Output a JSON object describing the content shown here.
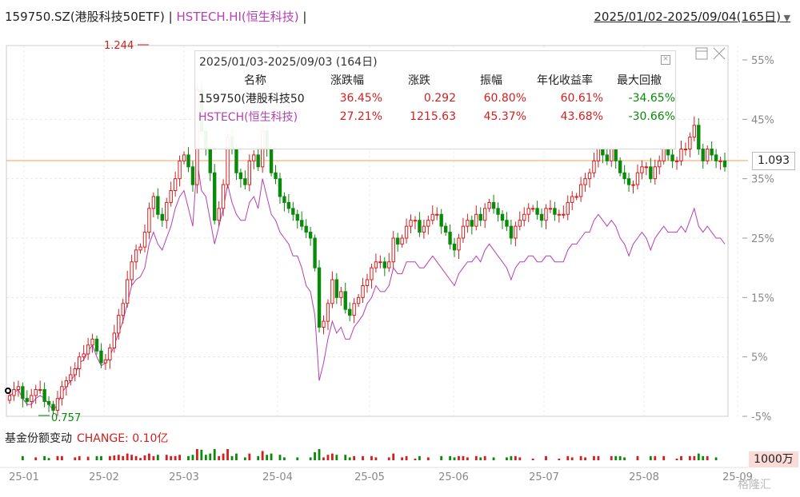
{
  "header": {
    "fund": "159750.SZ(港股科技50ETF)",
    "sep": "|",
    "index": "HSTECH.HI(恒生科技)",
    "sep2": "|",
    "range": "2025/01/02-2025/09/04(165日)"
  },
  "stats": {
    "range": "2025/01/03-2025/09/03 (164日)",
    "headers": [
      "名称",
      "涨跌幅",
      "涨跌",
      "振幅",
      "年化收益率",
      "最大回撤"
    ],
    "rows": [
      {
        "name": "159750(港股科技50",
        "chg_pct": "36.45%",
        "chg": "0.292",
        "amp": "60.80%",
        "annual": "60.61%",
        "mdd": "-34.65%"
      },
      {
        "name": "HSTECH(恒生科技)",
        "chg_pct": "27.21%",
        "chg": "1215.63",
        "amp": "45.37%",
        "annual": "43.68%",
        "mdd": "-30.66%"
      }
    ]
  },
  "flow": {
    "label": "基金份额变动",
    "change": "CHANGE: 0.10亿"
  },
  "last_price": "1.093",
  "vol_badge": "1000万",
  "watermark": "格隆汇",
  "colors": {
    "up": "#d21f1f",
    "down": "#0a8a0a",
    "index": "#b53fb5",
    "ref": "#f0a060"
  },
  "chart_data": {
    "type": "line",
    "x_ticks": [
      "25-01",
      "25-02",
      "25-03",
      "25-04",
      "25-05",
      "25-06",
      "25-07",
      "25-08",
      "25-09"
    ],
    "y_ticks": [
      "55%",
      "45%",
      "35%",
      "25%",
      "15%",
      "5%",
      "-5%"
    ],
    "ylim": [
      -5,
      55
    ],
    "annotations": {
      "high": "1.244",
      "low": "0.757"
    },
    "ref_line_value": 1.093,
    "series": [
      {
        "name": "159750.SZ(港股科技50ETF)",
        "style": "candlestick",
        "values": [
          -1.5,
          -0.5,
          0,
          -2,
          -2.5,
          -1.5,
          -0.5,
          -0.5,
          -2.5,
          -3,
          -4,
          -2,
          0,
          1,
          2,
          3,
          5,
          5.5,
          7,
          8,
          6,
          4,
          4.5,
          6.5,
          9,
          12,
          14,
          18,
          21,
          23,
          23.5,
          26,
          30,
          32,
          29,
          28,
          31,
          33,
          35,
          38,
          39,
          37,
          34,
          50,
          43,
          40,
          36,
          28,
          30,
          34,
          42,
          40,
          36,
          35,
          34,
          38,
          39,
          37,
          43,
          40,
          36,
          35,
          32,
          31,
          30,
          29,
          28,
          27,
          26,
          25,
          20,
          10,
          11,
          14,
          18,
          15,
          16,
          13,
          12,
          14,
          15,
          17,
          18,
          20,
          21,
          21,
          20,
          21,
          25,
          24,
          25,
          27,
          28,
          28,
          26,
          27,
          28,
          29,
          29,
          27,
          26,
          24,
          23,
          25,
          27,
          28,
          27,
          29,
          28,
          30,
          31,
          30,
          29,
          28,
          27,
          25,
          27,
          28,
          29,
          30,
          30,
          29,
          28,
          30,
          30,
          29,
          29,
          29,
          31,
          32,
          32,
          34,
          35,
          36,
          38,
          40,
          39,
          38,
          40,
          38,
          36,
          35,
          34,
          34,
          36,
          37,
          37,
          35,
          37,
          38,
          40,
          39,
          38,
          38,
          40,
          40,
          42,
          44,
          40,
          38,
          40,
          39,
          38,
          38,
          37
        ]
      },
      {
        "name": "HSTECH.HI(恒生科技)",
        "style": "line",
        "values": [
          -1.5,
          -1,
          -0.5,
          -2,
          -3,
          -3,
          -2,
          -1.5,
          -2,
          -3,
          -4,
          -3,
          -1,
          0,
          1,
          2,
          4,
          4.5,
          6,
          7,
          5,
          3.5,
          4,
          5,
          7,
          9,
          11,
          14,
          17,
          18,
          18.5,
          20,
          24,
          26,
          24,
          23,
          25,
          27,
          30,
          32,
          33,
          30,
          27,
          38,
          33,
          32,
          28,
          24,
          27,
          30,
          34,
          31,
          29,
          28,
          28,
          31,
          32,
          30,
          35,
          32,
          29,
          28,
          26,
          25,
          24,
          22,
          22,
          20,
          17,
          16,
          12,
          1,
          4,
          8,
          11,
          9,
          10,
          8,
          8,
          10,
          11,
          12,
          14,
          15,
          17,
          16,
          16,
          17,
          20,
          19,
          19,
          21,
          21,
          21,
          20,
          20,
          21,
          22,
          21,
          20,
          19,
          18,
          17,
          19,
          20,
          21,
          21,
          22,
          21,
          23,
          24,
          23,
          22,
          21,
          20,
          18,
          20,
          21,
          21,
          22,
          22,
          21,
          21,
          22,
          22,
          21,
          21,
          21,
          23,
          24,
          24,
          25,
          26,
          26,
          28,
          29,
          28,
          27,
          28,
          27,
          25,
          24,
          22,
          24,
          25,
          26,
          25,
          23,
          25,
          26,
          27,
          26,
          26,
          26,
          27,
          26,
          28,
          30,
          27,
          26,
          27,
          26,
          25,
          25,
          24
        ]
      }
    ]
  }
}
